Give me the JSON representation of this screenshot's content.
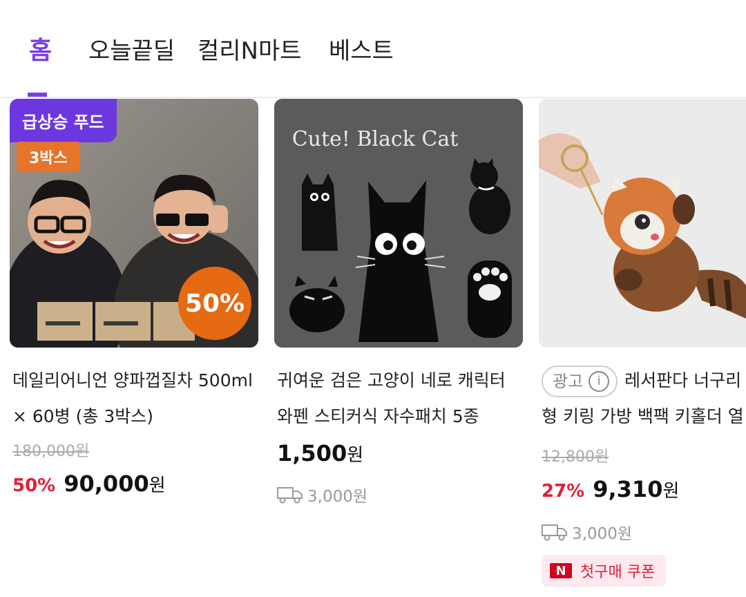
{
  "tabs": [
    {
      "label": "홈",
      "active": true
    },
    {
      "label": "오늘끝딜",
      "active": false
    },
    {
      "label": "컬리N마트",
      "active": false
    },
    {
      "label": "베스트",
      "active": false
    }
  ],
  "products": [
    {
      "badge_top": "급상승 푸드",
      "badge_box": "3박스",
      "badge_sale": "50%",
      "name_lines": [
        "데일리어니언 양파껍질차 500ml",
        "× 60병 (총 3박스)"
      ],
      "original_price": "180,000원",
      "discount_rate": "50%",
      "price": "90,000",
      "currency": "원"
    },
    {
      "image_text": "Cute! Black Cat",
      "name_lines": [
        "귀여운 검은 고양이 네로 캐릭터",
        "와펜 스티커식 자수패치 5종"
      ],
      "price": "1,500",
      "currency": "원",
      "shipping": "3,000원",
      "shipping_icon": "truck-icon"
    },
    {
      "ad_label": "광고",
      "name_lines": [
        "레서판다 너구리",
        "형 키링 가방 백팩 키홀더 열"
      ],
      "original_price": "12,800원",
      "discount_rate": "27%",
      "price": "9,310",
      "currency": "원",
      "shipping": "3,000원",
      "shipping_icon": "truck-icon",
      "coupon_icon": "N",
      "coupon": "첫구매 쿠폰"
    }
  ],
  "colors": {
    "accent": "#7b3fe4",
    "sale": "#e0203a",
    "badge_orange": "#e8732a"
  }
}
